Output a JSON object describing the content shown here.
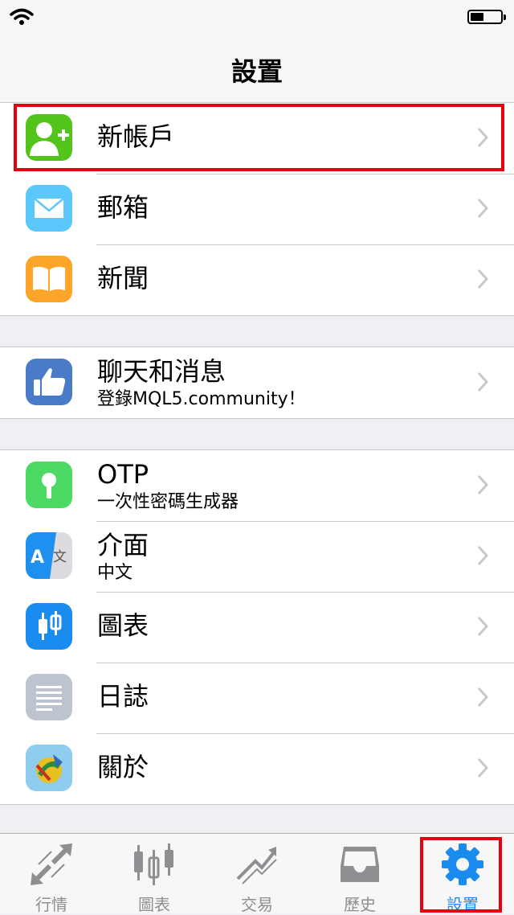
{
  "navbar": {
    "title": "設置"
  },
  "settings": {
    "group1": [
      {
        "label": "新帳戶",
        "icon": "add-user-icon"
      },
      {
        "label": "郵箱",
        "icon": "mail-icon"
      },
      {
        "label": "新聞",
        "icon": "book-icon"
      }
    ],
    "group2": [
      {
        "label": "聊天和消息",
        "sub": "登錄MQL5.community！",
        "icon": "thumbs-up-icon"
      }
    ],
    "group3": [
      {
        "label": "OTP",
        "sub": "一次性密碼生成器",
        "icon": "keyhole-icon"
      },
      {
        "label": "介面",
        "sub": "中文",
        "icon": "translate-icon"
      },
      {
        "label": "圖表",
        "icon": "candlestick-icon"
      },
      {
        "label": "日誌",
        "icon": "journal-icon"
      },
      {
        "label": "關於",
        "icon": "metatrader-logo-icon"
      }
    ]
  },
  "tabbar": {
    "items": [
      {
        "label": "行情",
        "icon": "quotes-arrows-icon"
      },
      {
        "label": "圖表",
        "icon": "chart-candles-icon"
      },
      {
        "label": "交易",
        "icon": "trade-icon"
      },
      {
        "label": "歷史",
        "icon": "inbox-icon"
      },
      {
        "label": "設置",
        "icon": "gear-icon",
        "active": true
      }
    ]
  },
  "colors": {
    "accent": "#1a8cf0",
    "highlight": "#e8000c",
    "tab_inactive": "#8e8e93"
  }
}
